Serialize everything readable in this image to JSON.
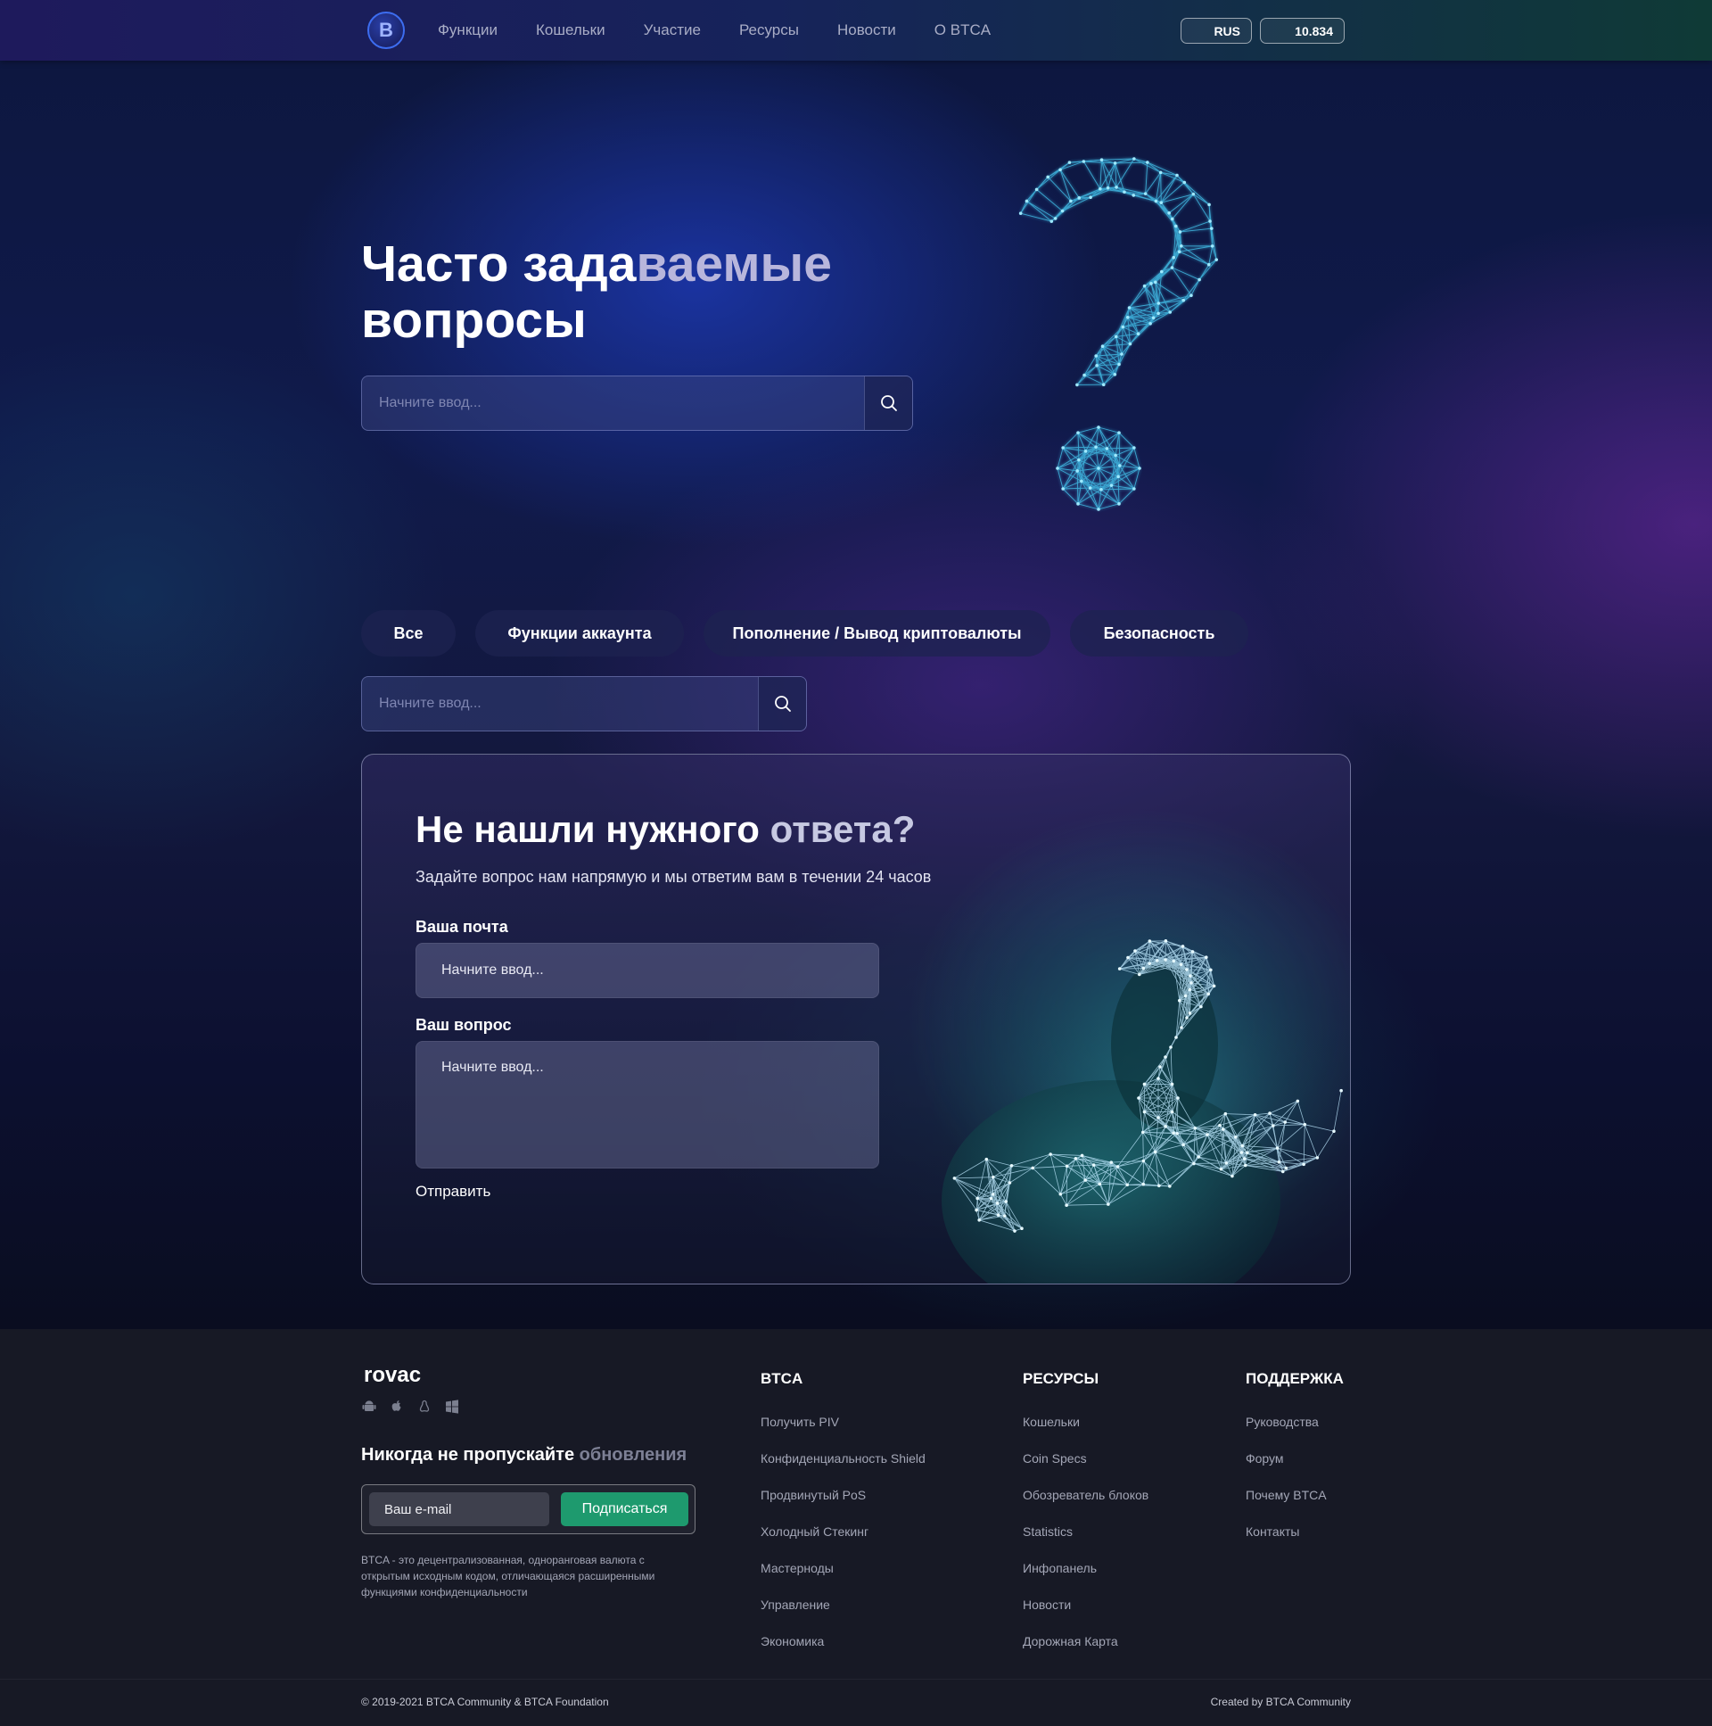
{
  "nav": {
    "logo_letter": "B",
    "items": [
      "Функции",
      "Кошельки",
      "Участие",
      "Ресурсы",
      "Новости",
      "О BTCA"
    ],
    "lang": "RUS",
    "price": "10.834"
  },
  "hero": {
    "title_part1": "Часто зада",
    "title_part2": "ваемые",
    "title_line2": "вопросы",
    "search_placeholder": "Начните ввод..."
  },
  "tabs": [
    "Все",
    "Функции аккаунта",
    "Пополнение / Вывод криптовалюты",
    "Безопасность"
  ],
  "filter_search": {
    "placeholder": "Начните ввод..."
  },
  "ask": {
    "title_part1": "Не нашли нужного ",
    "title_part2": "ответа?",
    "subtitle": "Задайте вопрос нам напрямую и мы ответим вам в течении 24 часов",
    "email_label": "Ваша почта",
    "email_placeholder": "Начните ввод...",
    "question_label": "Ваш вопрос",
    "question_placeholder": "Начните ввод...",
    "submit": "Отправить"
  },
  "footer": {
    "brand": "rovac",
    "os_icons": [
      "android-icon",
      "apple-icon",
      "linux-icon",
      "windows-icon"
    ],
    "newsletter_part1": "Никогда не пропускайте ",
    "newsletter_part2": "обновления",
    "email_placeholder": "Ваш e-mail",
    "subscribe": "Подписаться",
    "description": "BTCA - это децентрализованная, одноранговая валюта с открытым исходным кодом, отличающаяся расширенными функциями конфиденциальности",
    "columns": [
      {
        "title": "BTCA",
        "links": [
          "Получить PIV",
          "Конфиденциальность Shield",
          "Продвинутый PoS",
          "Холодный Стекинг",
          "Мастерноды",
          "Управление",
          "Экономика"
        ]
      },
      {
        "title": "РЕСУРСЫ",
        "links": [
          "Кошельки",
          "Coin Specs",
          "Обозреватель блоков",
          "Statistics",
          "Инфопанель",
          "Новости",
          "Дорожная Карта"
        ]
      },
      {
        "title": "ПОДДЕРЖКА",
        "links": [
          "Руководства",
          "Форум",
          "Почему BTCA",
          "Контакты"
        ]
      }
    ],
    "copyright": "© 2019-2021 BTCA Community & BTCA Foundation",
    "created_by": "Created by BTCA Community"
  },
  "colors": {
    "accent_green": "#1e9a6e",
    "nav_gradient_left": "#1e1a5c",
    "nav_gradient_right": "#0f3a36",
    "footer_bg": "#171925"
  }
}
